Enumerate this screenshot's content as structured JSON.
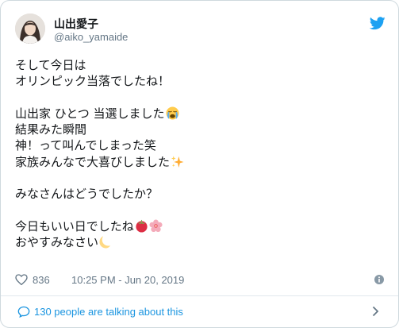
{
  "colors": {
    "accent": "#1da1f2",
    "link": "#1b95e0",
    "muted": "#657786",
    "border": "#cfd9de"
  },
  "tweet": {
    "author_name": "山出愛子",
    "author_handle": "@aiko_yamaide",
    "lines": {
      "l1": "そして今日は",
      "l2": "オリンピック当落でしたね！",
      "l3": "山出家 ひとつ 当選しました",
      "l4": "結果みた瞬間",
      "l5": "神！って叫んでしまった笑",
      "l6": "家族みんなで大喜びしました",
      "l7": "みなさんはどうでしたか？",
      "l8": "今日もいい日でしたね",
      "l9": "おやすみなさい"
    },
    "emojis": [
      "crying-face-emoji",
      "sparkles-emoji",
      "tomato-emoji",
      "cherry-blossom-emoji",
      "crescent-moon-emoji"
    ],
    "likes": "836",
    "timestamp": "10:25 PM - Jun 20, 2019"
  },
  "footer": {
    "talking_text": "130 people are talking about this"
  }
}
